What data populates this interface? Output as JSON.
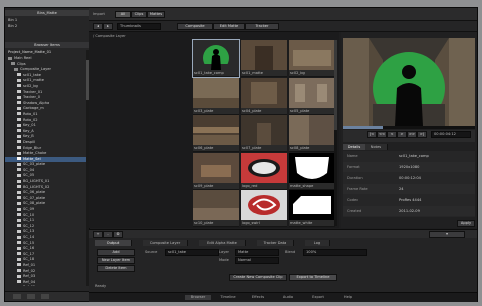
{
  "app": {
    "accent": "#3c5a80",
    "chroma_green": "#2ea144"
  },
  "left": {
    "panel_title": "Bins_Matte",
    "top_items": [
      "Bin 1",
      "Bin 2"
    ],
    "browser_title": "Browser Items",
    "tree_header": "Project_Name_Matte_01",
    "tree": [
      {
        "label": "Main Reel",
        "color": "#8a8a8a"
      },
      {
        "label": "Clips",
        "color": "#8a8a8a"
      },
      {
        "label": "Composite_Layer",
        "color": "#8a8a8a"
      },
      {
        "label": "sc01_take",
        "color": "#c9c9c9"
      },
      {
        "label": "sc01_matte",
        "color": "#c9c9c9"
      },
      {
        "label": "sc02_bg",
        "color": "#c9c9c9"
      },
      {
        "label": "Tracker_01",
        "color": "#c9c9c9"
      },
      {
        "label": "Tracker_0",
        "color": "#c9c9c9"
      },
      {
        "label": "Shadow_Alpha",
        "color": "#c9c9c9"
      },
      {
        "label": "Garbage_m",
        "color": "#c9c9c9"
      },
      {
        "label": "Roto_01",
        "color": "#c9c9c9"
      },
      {
        "label": "Roto_02",
        "color": "#c9c9c9"
      },
      {
        "label": "Key_01",
        "color": "#c9c9c9"
      },
      {
        "label": "Key_A",
        "color": "#c9c9c9"
      },
      {
        "label": "Key_B",
        "color": "#c9c9c9"
      },
      {
        "label": "Despill",
        "color": "#c9c9c9"
      },
      {
        "label": "Edge_Blur",
        "color": "#c9c9c9"
      },
      {
        "label": "Matte_Choke",
        "color": "#c9c9c9"
      },
      {
        "label": "Matte_Sel",
        "color": "#ffffff",
        "selected": true
      },
      {
        "label": "SC_03_plate",
        "color": "#c9c9c9"
      },
      {
        "label": "SC_04",
        "color": "#c9c9c9"
      },
      {
        "label": "SC_05",
        "color": "#c9c9c9"
      },
      {
        "label": "BG_LIGHTS_01",
        "color": "#c9c9c9"
      },
      {
        "label": "BG_LIGHTS_02",
        "color": "#c9c9c9"
      },
      {
        "label": "SC_06_plate",
        "color": "#c9c9c9"
      },
      {
        "label": "SC_07_plate",
        "color": "#c9c9c9"
      },
      {
        "label": "SC_08_plate",
        "color": "#c9c9c9"
      },
      {
        "label": "SC_09",
        "color": "#c9c9c9"
      },
      {
        "label": "SC_10",
        "color": "#c9c9c9"
      },
      {
        "label": "SC_11",
        "color": "#c9c9c9"
      },
      {
        "label": "SC_12",
        "color": "#c9c9c9"
      },
      {
        "label": "SC_13",
        "color": "#c9c9c9"
      },
      {
        "label": "SC_14",
        "color": "#c9c9c9"
      },
      {
        "label": "SC_15",
        "color": "#c9c9c9"
      },
      {
        "label": "SC_16",
        "color": "#c9c9c9"
      },
      {
        "label": "SC_17",
        "color": "#c9c9c9"
      },
      {
        "label": "SC_18",
        "color": "#c9c9c9"
      },
      {
        "label": "Ref_01",
        "color": "#c9c9c9"
      },
      {
        "label": "Ref_02",
        "color": "#c9c9c9"
      },
      {
        "label": "Ref_03",
        "color": "#c9c9c9"
      },
      {
        "label": "Ref_04",
        "color": "#c9c9c9"
      },
      {
        "label": "Ref_05",
        "color": "#c9c9c9"
      }
    ]
  },
  "toolbar": {
    "label": "Import",
    "tabs": [
      "All",
      "Clips",
      "Mattes"
    ],
    "dropdown": "Thumbnails",
    "buttons": [
      "Composite",
      "Edit Matte",
      "Tracker"
    ]
  },
  "browser": {
    "path": "/ Composite Layer",
    "thumbs": [
      {
        "cap": "sc01_take_comp"
      },
      {
        "cap": "sc01_matte"
      },
      {
        "cap": "sc02_bg"
      },
      {
        "cap": "sc03_plate"
      },
      {
        "cap": "sc04_plate"
      },
      {
        "cap": "sc05_plate"
      },
      {
        "cap": "sc06_plate"
      },
      {
        "cap": "sc07_plate"
      },
      {
        "cap": "sc08_plate"
      },
      {
        "cap": "sc09_plate"
      },
      {
        "cap": "logo_red"
      },
      {
        "cap": "matte_shape"
      },
      {
        "cap": "sc10_plate"
      },
      {
        "cap": "logo_swirl"
      },
      {
        "cap": "matte_white"
      }
    ]
  },
  "viewer": {
    "timecode": "00:00:04:12",
    "transport": [
      "|<",
      "<<",
      "<",
      ">",
      ">>",
      ">|"
    ],
    "tabs": [
      "Details",
      "Notes"
    ],
    "info": [
      {
        "k": "Name",
        "v": "sc01_take_comp"
      },
      {
        "k": "Format",
        "v": "1920x1080"
      },
      {
        "k": "Duration",
        "v": "00:00:12:04"
      },
      {
        "k": "Frame Rate",
        "v": "24"
      },
      {
        "k": "Codec",
        "v": "ProRes 4444"
      },
      {
        "k": "Created",
        "v": "2011-02-09"
      }
    ],
    "apply": "Apply"
  },
  "bottom": {
    "tabs": [
      "Output",
      "Composite Layer",
      "Edit Alpha Matte",
      "Tracker Data",
      "Log"
    ],
    "left_buttons": [
      "Add",
      "New Layer Item",
      "Delete Item"
    ],
    "labels": [
      "Source",
      "Layer",
      "Mode",
      "Blend"
    ],
    "values": [
      "sc01_take",
      "Matte",
      "Normal",
      "100%"
    ],
    "center_buttons": [
      "Create New Composite Clip",
      "Export to Timeline"
    ],
    "status": "Ready"
  },
  "taskbar": [
    "Browser",
    "Timeline",
    "Effects",
    "Audio",
    "Export",
    "Help"
  ]
}
